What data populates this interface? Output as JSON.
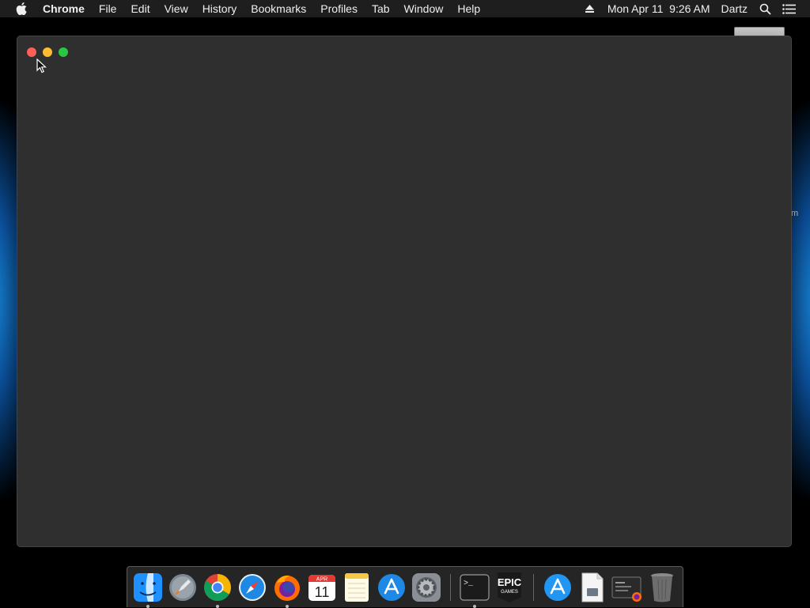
{
  "menubar": {
    "app_name": "Chrome",
    "items": [
      "File",
      "Edit",
      "View",
      "History",
      "Bookmarks",
      "Profiles",
      "Tab",
      "Window",
      "Help"
    ],
    "datetime": "Mon Apr 11  9:26 AM",
    "user": "Dartz",
    "icons": [
      "apple-icon",
      "eject-icon",
      "search-icon",
      "notification-center-icon"
    ]
  },
  "window": {
    "title": "",
    "buttons": [
      "close",
      "minimize",
      "zoom"
    ],
    "colors": {
      "background": "#2f2f2f",
      "close": "#fe5f57",
      "minimize": "#febc2e",
      "zoom": "#28c840"
    }
  },
  "desktop": {
    "partial_label": "m"
  },
  "dock": {
    "apps": [
      {
        "name": "Finder",
        "icon": "finder-icon",
        "running": true
      },
      {
        "name": "Launchpad",
        "icon": "launchpad-icon",
        "running": false
      },
      {
        "name": "Google Chrome",
        "icon": "chrome-icon",
        "running": true
      },
      {
        "name": "Safari",
        "icon": "safari-icon",
        "running": false
      },
      {
        "name": "Firefox",
        "icon": "firefox-icon",
        "running": true
      },
      {
        "name": "Calendar",
        "icon": "calendar-icon",
        "running": false,
        "month": "APR",
        "day": "11"
      },
      {
        "name": "Notes",
        "icon": "notes-icon",
        "running": false
      },
      {
        "name": "App Store",
        "icon": "app-store-icon",
        "running": false
      },
      {
        "name": "System Preferences",
        "icon": "system-preferences-icon",
        "running": false
      },
      {
        "name": "Terminal",
        "icon": "terminal-icon",
        "running": true,
        "prompt": ">_"
      },
      {
        "name": "Epic Games Launcher",
        "icon": "epic-games-icon",
        "running": false,
        "line1": "EPIC",
        "line2": "GAMES"
      },
      {
        "name": "App Store Download",
        "icon": "app-store-download-icon",
        "running": false
      },
      {
        "name": "Preview Document",
        "icon": "document-icon",
        "running": false
      },
      {
        "name": "Downloads Stack",
        "icon": "downloads-stack-icon",
        "running": false
      },
      {
        "name": "Trash",
        "icon": "trash-icon",
        "running": false
      }
    ]
  }
}
